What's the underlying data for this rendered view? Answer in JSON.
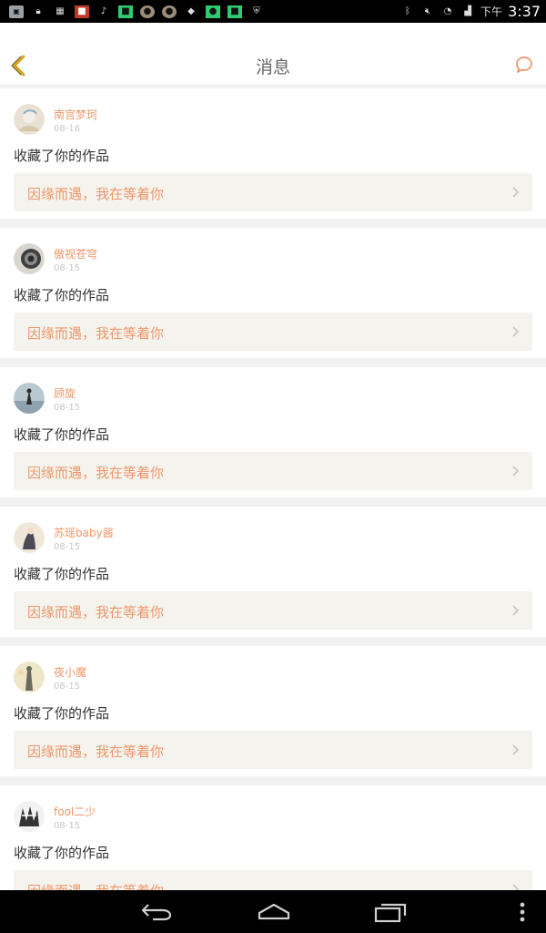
{
  "statusbar": {
    "time_prefix": "下午",
    "time": "3:37",
    "icons": [
      "notification-icon",
      "lock-icon",
      "image-icon",
      "app-icon",
      "tiktok-icon",
      "app-icon",
      "app-icon",
      "app-icon",
      "app-icon",
      "app-icon",
      "app-icon",
      "shield-icon",
      "bluetooth-icon",
      "mute-icon",
      "wifi-icon",
      "signal-icon"
    ]
  },
  "header": {
    "title": "消息",
    "back_icon": "chevron-left-icon",
    "chat_icon": "chat-bubble-icon"
  },
  "colors": {
    "accent": "#f0976a",
    "back_accent": "#d6a21c",
    "quote_bg": "#f4f3ee"
  },
  "messages": [
    {
      "name": "南宫梦珂",
      "date": "08-16",
      "action": "收藏了你的作品",
      "quote": "因缘而遇，我在等着你"
    },
    {
      "name": "傲视苍穹",
      "date": "08-15",
      "action": "收藏了你的作品",
      "quote": "因缘而遇，我在等着你"
    },
    {
      "name": "顾旋",
      "date": "08-15",
      "action": "收藏了你的作品",
      "quote": "因缘而遇，我在等着你"
    },
    {
      "name": "苏瑶baby酱",
      "date": "08-15",
      "action": "收藏了你的作品",
      "quote": "因缘而遇，我在等着你"
    },
    {
      "name": "夜小魔",
      "date": "08-15",
      "action": "收藏了你的作品",
      "quote": "因缘而遇，我在等着你"
    },
    {
      "name": "fool二少",
      "date": "08-15",
      "action": "收藏了你的作品",
      "quote": "因缘而遇，我在等着你"
    }
  ],
  "navbar": {
    "items": [
      "back-icon",
      "home-icon",
      "recents-icon",
      "menu-icon"
    ]
  }
}
